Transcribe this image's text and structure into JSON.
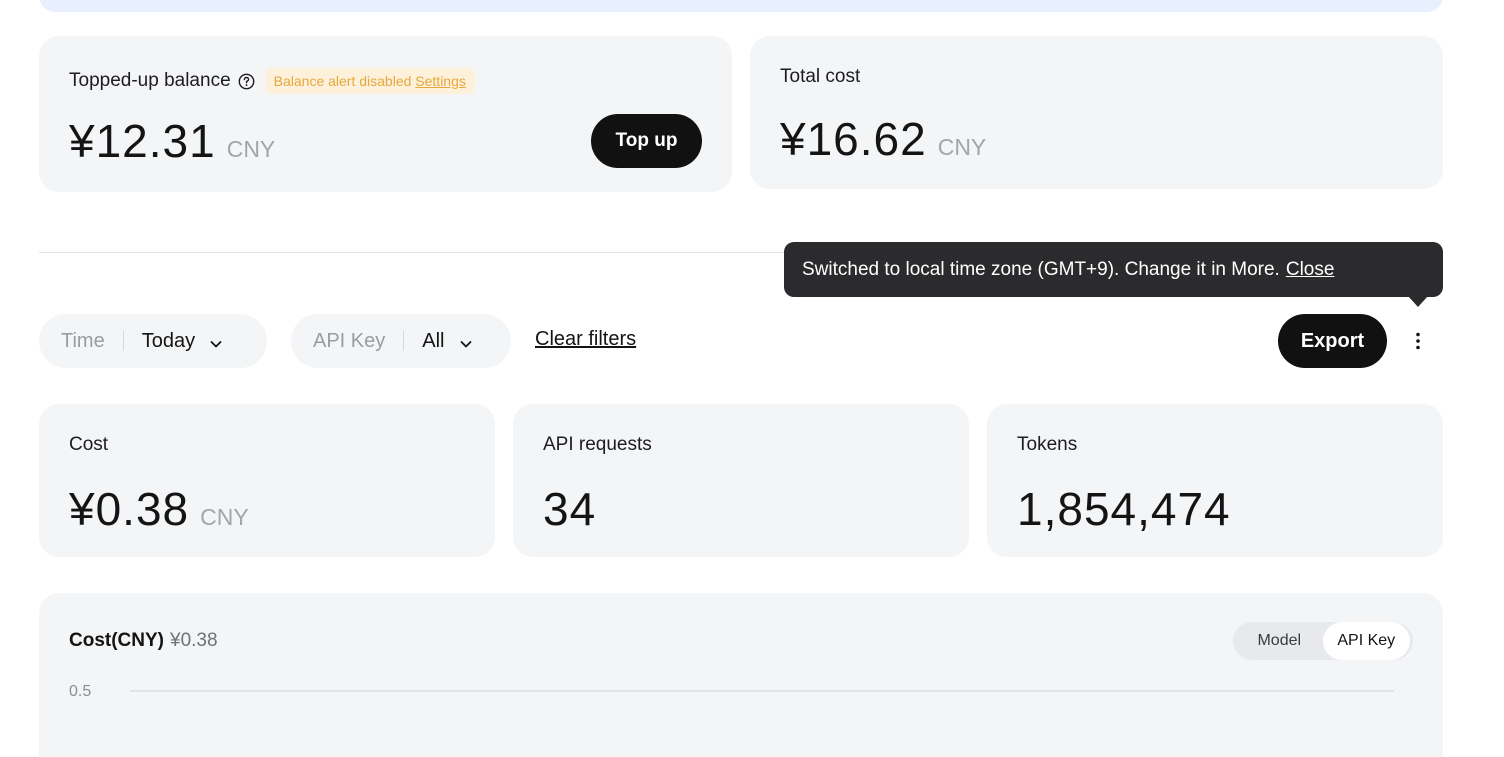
{
  "balance": {
    "label": "Topped-up balance",
    "alert_text": "Balance alert disabled",
    "alert_link": "Settings",
    "value": "¥12.31",
    "unit": "CNY",
    "topup_label": "Top up"
  },
  "total_cost": {
    "label": "Total cost",
    "value": "¥16.62",
    "unit": "CNY"
  },
  "tooltip": {
    "text": "Switched to local time zone (GMT+9). Change it in More.",
    "close_label": "Close"
  },
  "filters": {
    "time": {
      "label": "Time",
      "value": "Today"
    },
    "api_key": {
      "label": "API Key",
      "value": "All"
    },
    "clear_label": "Clear filters"
  },
  "toolbar": {
    "export_label": "Export"
  },
  "stats": {
    "cost": {
      "label": "Cost",
      "value": "¥0.38",
      "unit": "CNY"
    },
    "requests": {
      "label": "API requests",
      "value": "34"
    },
    "tokens": {
      "label": "Tokens",
      "value": "1,854,474"
    }
  },
  "chart": {
    "title": "Cost(CNY)",
    "total": "¥0.38",
    "toggle": {
      "model": "Model",
      "api_key": "API Key",
      "selected": "API Key"
    }
  },
  "chart_data": {
    "type": "bar",
    "title": "Cost(CNY) ¥0.38",
    "xlabel": "",
    "ylabel": "",
    "y_ticks": [
      "0.5"
    ],
    "ylim": [
      0,
      0.5
    ],
    "grid": true
  },
  "colors": {
    "card_bg": "#f4f5f7",
    "primary_button": "#111111",
    "tooltip_bg": "#2b2b2d",
    "alert_bg": "#fdf1dc",
    "alert_text": "#e8a73a",
    "muted_text": "#a4a5a8"
  }
}
